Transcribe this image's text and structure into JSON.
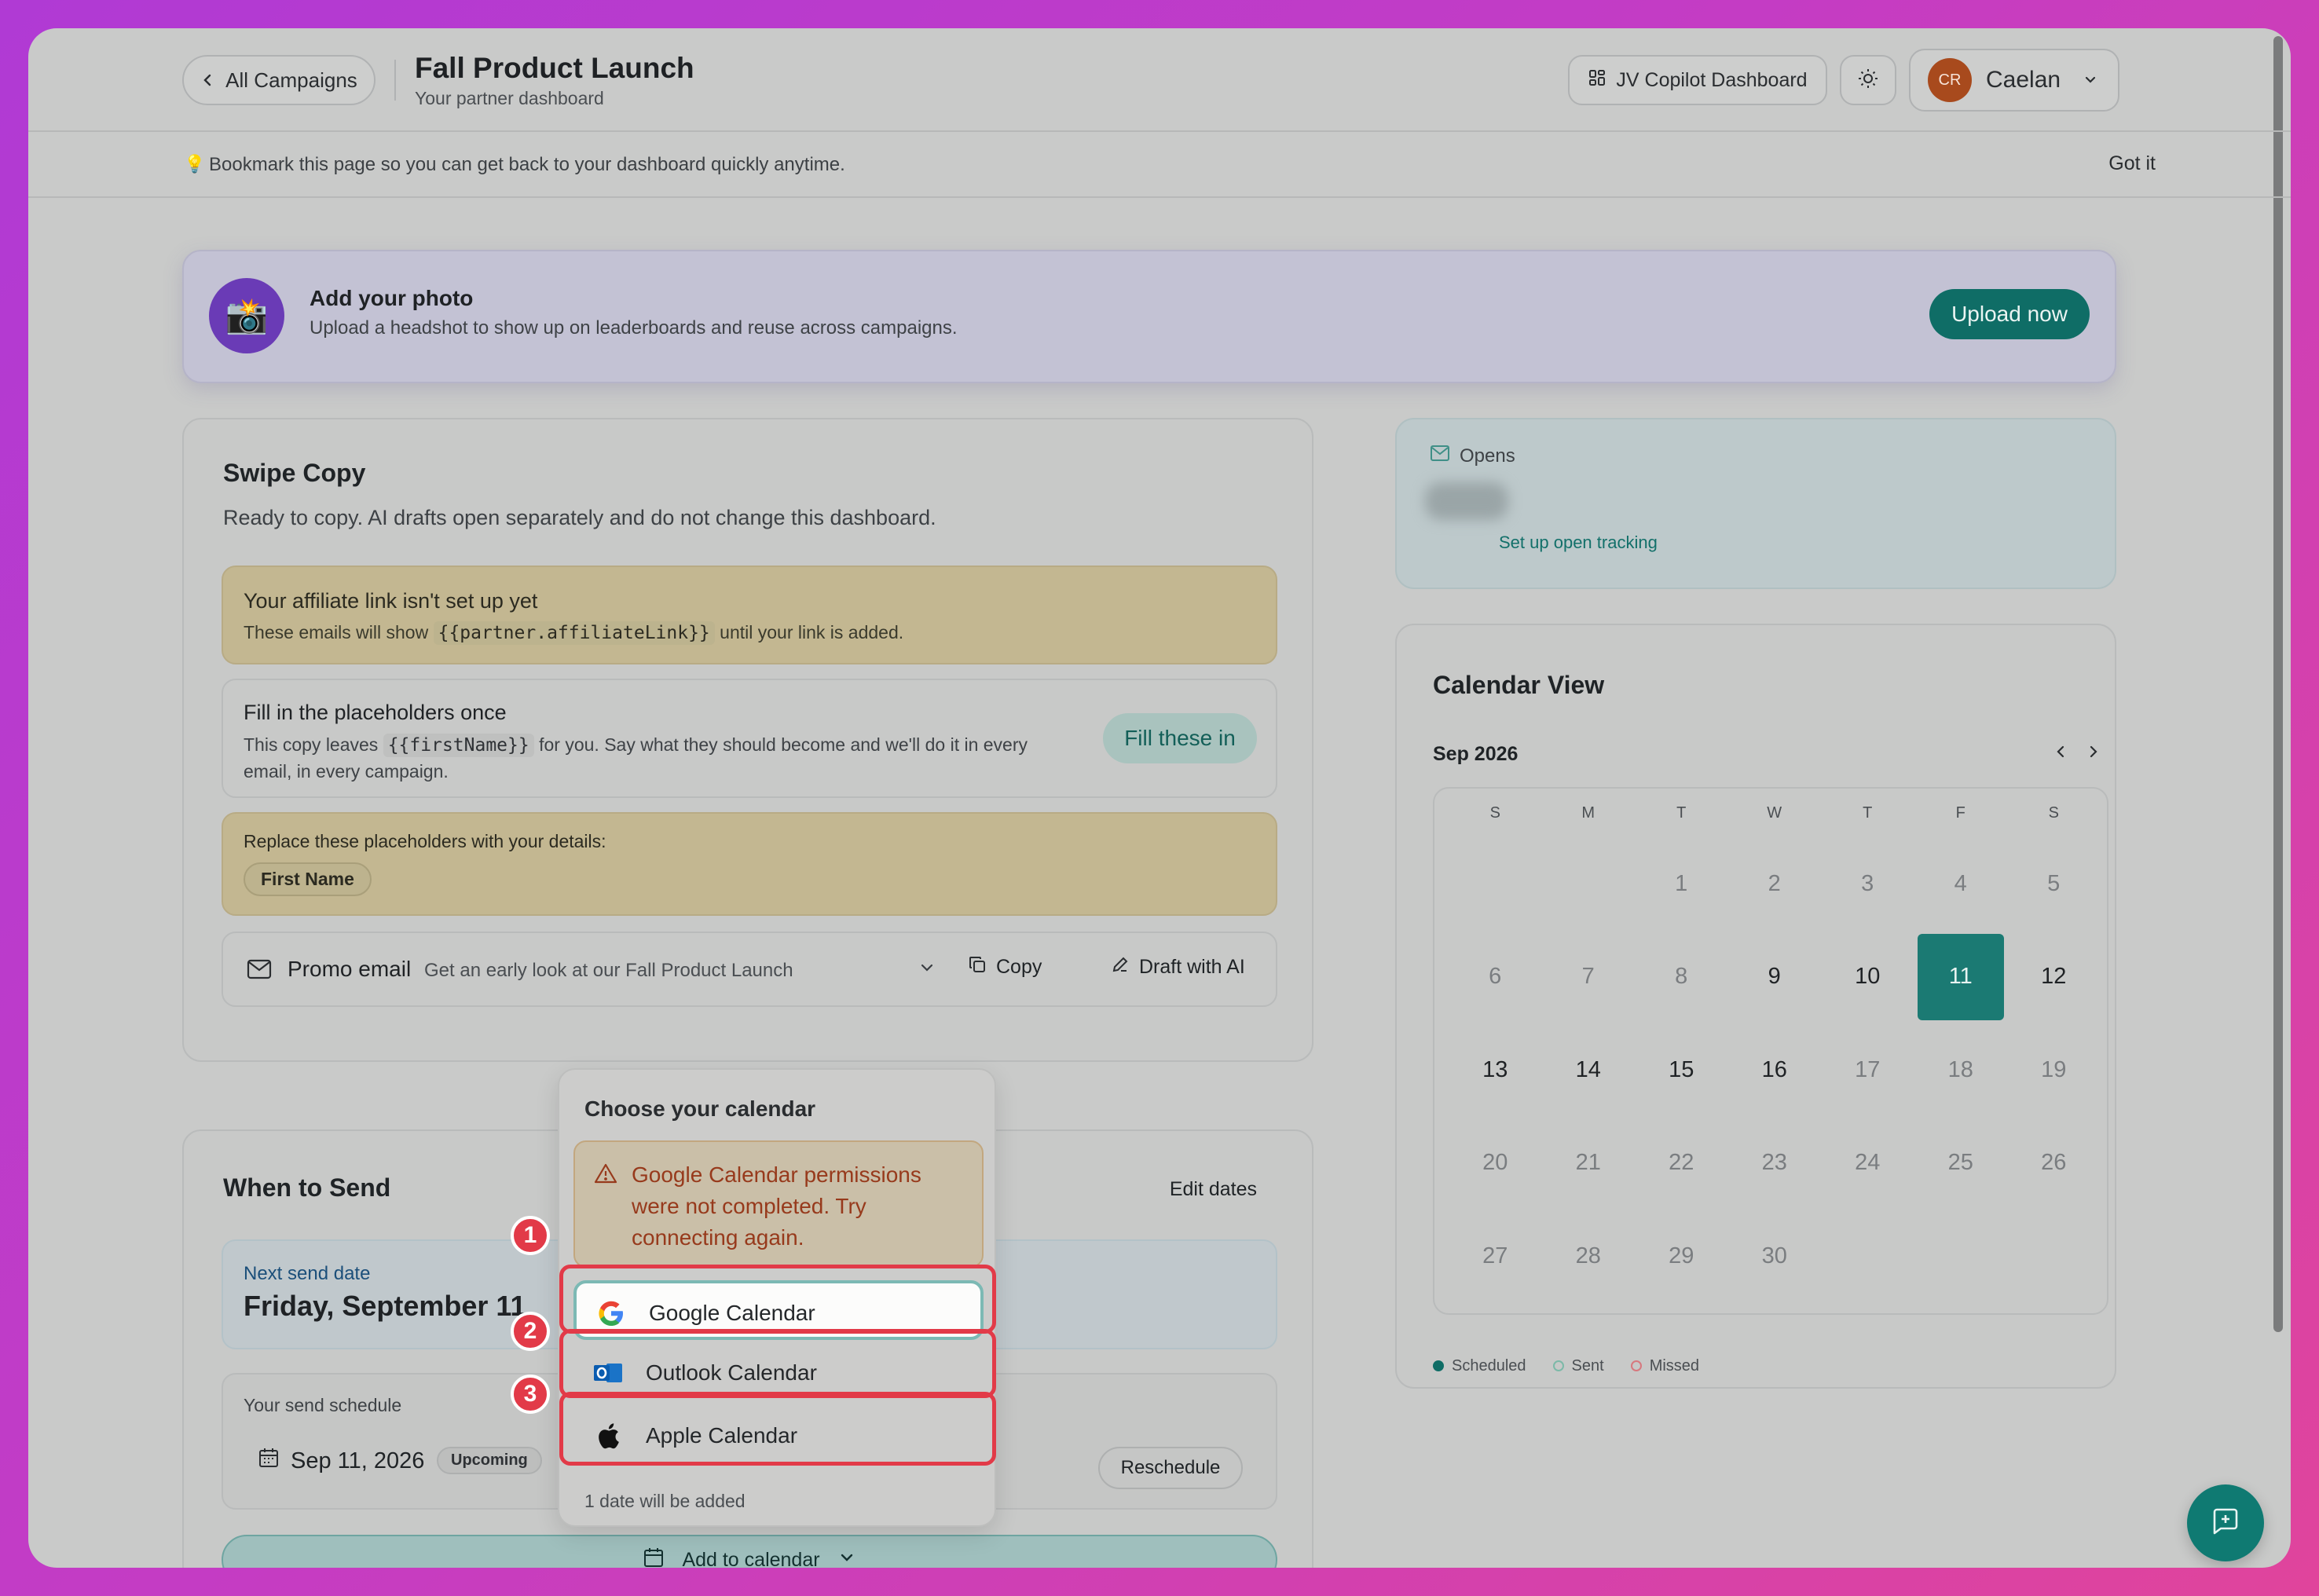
{
  "header": {
    "back_label": "All Campaigns",
    "title": "Fall Product Launch",
    "subtitle": "Your partner dashboard",
    "dashboard_label": "JV Copilot Dashboard",
    "user_initials": "CR",
    "user_name": "Caelan"
  },
  "bookmark": {
    "text": "Bookmark this page so you can get back to your dashboard quickly anytime.",
    "dismiss_label": "Got it"
  },
  "photo": {
    "title": "Add your photo",
    "description": "Upload a headshot to show up on leaderboards and reuse across campaigns.",
    "button_label": "Upload now"
  },
  "swipe": {
    "title": "Swipe Copy",
    "subtitle": "Ready to copy. AI drafts open separately and do not change this dashboard.",
    "affiliate_title": "Your affiliate link isn't set up yet",
    "affiliate_pre": "These emails will show",
    "affiliate_code": "{{partner.affiliateLink}}",
    "affiliate_post": "until your link is added.",
    "fill_title": "Fill in the placeholders once",
    "fill_pre": "This copy leaves",
    "fill_code": "{{firstName}}",
    "fill_post": "for you. Say what they should become and we'll do it in every email, in every campaign.",
    "fill_button": "Fill these in",
    "replace_title": "Replace these placeholders with your details:",
    "replace_chip": "First Name",
    "promo_label": "Promo email",
    "promo_subject": "Get an early look at our Fall Product Launch",
    "copy_label": "Copy",
    "draft_label": "Draft with AI"
  },
  "when": {
    "title": "When to Send",
    "edit_label": "Edit dates",
    "next_label": "Next send date",
    "next_date": "Friday, September 11",
    "schedule_label": "Your send schedule",
    "schedule_date": "Sep 11, 2026",
    "schedule_badge": "Upcoming",
    "reschedule_label": "Reschedule",
    "add_calendar_label": "Add to calendar"
  },
  "opens": {
    "label": "Opens",
    "link": "Set up open tracking"
  },
  "calendar": {
    "title": "Calendar View",
    "month": "Sep 2026",
    "weekdays": [
      "S",
      "M",
      "T",
      "W",
      "T",
      "F",
      "S"
    ],
    "weeks": [
      [
        "",
        "",
        "1",
        "2",
        "3",
        "4",
        "5"
      ],
      [
        "6",
        "7",
        "8",
        "9",
        "10",
        "11",
        "12"
      ],
      [
        "13",
        "14",
        "15",
        "16",
        "17",
        "18",
        "19"
      ],
      [
        "20",
        "21",
        "22",
        "23",
        "24",
        "25",
        "26"
      ],
      [
        "27",
        "28",
        "29",
        "30",
        "",
        "",
        ""
      ]
    ],
    "selected_day": "11",
    "bold_days": [
      "9",
      "10",
      "12",
      "13",
      "14",
      "15",
      "16"
    ],
    "legend": {
      "scheduled": "Scheduled",
      "sent": "Sent",
      "missed": "Missed"
    },
    "colors": {
      "scheduled": "#0f6d66",
      "sent": "#7cb9a8",
      "missed": "#d7787e",
      "selected": "#1b7a73"
    }
  },
  "popup": {
    "title": "Choose your calendar",
    "warning": "Google Calendar permissions were not completed. Try connecting again.",
    "options": [
      {
        "label": "Google Calendar",
        "icon": "google-icon"
      },
      {
        "label": "Outlook Calendar",
        "icon": "outlook-icon"
      },
      {
        "label": "Apple Calendar",
        "icon": "apple-icon"
      }
    ],
    "footer": "1 date will be added"
  },
  "annotations": [
    "1",
    "2",
    "3"
  ]
}
